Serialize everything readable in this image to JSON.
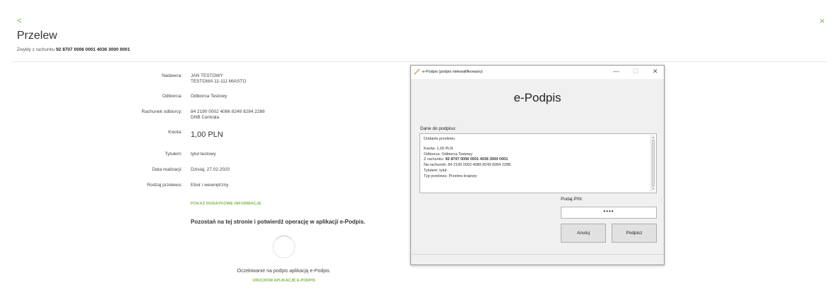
{
  "header": {
    "back_glyph": "<",
    "close_glyph": "×",
    "title": "Przelew",
    "account_prefix": "Zwykły z rachunku",
    "account_number": "92 8707 0006 0001 4036 3000 0001"
  },
  "details": [
    {
      "label": "Nadawca:",
      "value": "JAN TESTOWY",
      "value2": "TESTOWA 11-111 MIASTO"
    },
    {
      "label": "Odbiorca:",
      "value": "Odbiorca Testowy"
    },
    {
      "label": "Rachunek odbiorcy:",
      "value": "84 2190 0002 4086 8249 8284 2288",
      "value2": "DNB Centrala"
    },
    {
      "label": "Kwota:",
      "value": "1,00 PLN"
    },
    {
      "label": "Tytułem:",
      "value": "tytuł testowy"
    },
    {
      "label": "Data realizacji:",
      "value": "Dzisiaj, 27.02.2020"
    },
    {
      "label": "Rodzaj przelewu:",
      "value": "Elixir i wewnętrzny"
    }
  ],
  "links": {
    "more_info": "POKAŻ DODATKOWE INFORMACJE",
    "launch_app": "URUCHOM APLIKACJĘ E-PODPIS"
  },
  "messages": {
    "stay": "Pozostań na tej stronie i potwierdź operację w aplikacji e-Podpis.",
    "waiting": "Oczekiwanie na podpis aplikacją e-Podpis."
  },
  "dialog": {
    "window_title": "e-Podpis (podpis niekwalifikowany)",
    "minimize": "—",
    "maximize": "☐",
    "close": "✕",
    "heading": "e-Podpis",
    "section_label": "Dane do podpisu:",
    "sig_lines": {
      "op": "Dodanie przelewu",
      "amount": "Kwota: 1,00 PLN",
      "recipient": "Odbiorca:   Odbiorca Testowy",
      "from_label": "Z rachunku: ",
      "from_value": "92 8707 0006 0001 4036 3000 0001",
      "to": "Na rachunek: 84 2190 0002 4086 8249 8284 2288",
      "title": "Tytułem: tytuł",
      "type": "Typ przelewu: Przelew krajowy"
    },
    "pin_label": "Podaj PIN:",
    "pin_value": "••••",
    "cancel_label": "Anuluj",
    "sign_label": "Podpisz"
  },
  "colors": {
    "accent": "#7ab648",
    "icon_orange": "#e8862a"
  },
  "icons": {
    "back": "chevron-left-icon",
    "close": "close-icon",
    "app": "pen-icon"
  }
}
